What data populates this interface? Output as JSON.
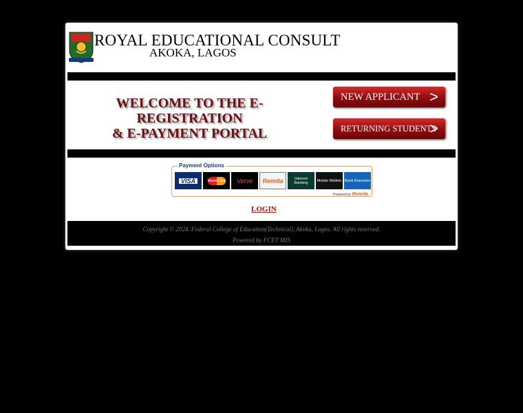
{
  "header": {
    "title": "ROYAL EDUCATIONAL CONSULT",
    "subtitle": "AKOKA, LAGOS",
    "logo_icon": "school-crest-icon"
  },
  "welcome": {
    "line1": "WELCOME TO THE E-REGISTRATION",
    "line2": "& E-PAYMENT PORTAL"
  },
  "buttons": {
    "new_applicant": "NEW APPLICANT",
    "returning_students": "RETURNING STUDENTS",
    "arrow": ">"
  },
  "payment": {
    "title": "Payment Options",
    "options": [
      "VISA",
      "MasterCard",
      "Verve",
      "Remita",
      "Internet Banking",
      "Mobile Wallets",
      "Bank Branches"
    ],
    "powered_prefix": "Powered by",
    "powered_brand": "Remita"
  },
  "login": "LOGIN",
  "footer": {
    "copyright": "Copyright © 2024. Federal College of Education(Technical), Akoka, Lagos. All rights reserved.",
    "powered_by": "Powered by FCET MIS"
  },
  "colors": {
    "button_red": "#8e0c0f",
    "welcome_text": "#6b0f12",
    "login_red": "#cc0000",
    "payment_border": "#f3a15a"
  }
}
